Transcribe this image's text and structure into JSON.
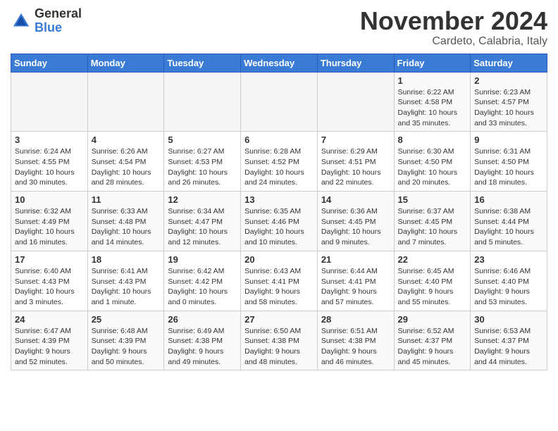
{
  "header": {
    "logo_general": "General",
    "logo_blue": "Blue",
    "month_title": "November 2024",
    "location": "Cardeto, Calabria, Italy"
  },
  "days_of_week": [
    "Sunday",
    "Monday",
    "Tuesday",
    "Wednesday",
    "Thursday",
    "Friday",
    "Saturday"
  ],
  "weeks": [
    [
      {
        "day": "",
        "info": ""
      },
      {
        "day": "",
        "info": ""
      },
      {
        "day": "",
        "info": ""
      },
      {
        "day": "",
        "info": ""
      },
      {
        "day": "",
        "info": ""
      },
      {
        "day": "1",
        "info": "Sunrise: 6:22 AM\nSunset: 4:58 PM\nDaylight: 10 hours and 35 minutes."
      },
      {
        "day": "2",
        "info": "Sunrise: 6:23 AM\nSunset: 4:57 PM\nDaylight: 10 hours and 33 minutes."
      }
    ],
    [
      {
        "day": "3",
        "info": "Sunrise: 6:24 AM\nSunset: 4:55 PM\nDaylight: 10 hours and 30 minutes."
      },
      {
        "day": "4",
        "info": "Sunrise: 6:26 AM\nSunset: 4:54 PM\nDaylight: 10 hours and 28 minutes."
      },
      {
        "day": "5",
        "info": "Sunrise: 6:27 AM\nSunset: 4:53 PM\nDaylight: 10 hours and 26 minutes."
      },
      {
        "day": "6",
        "info": "Sunrise: 6:28 AM\nSunset: 4:52 PM\nDaylight: 10 hours and 24 minutes."
      },
      {
        "day": "7",
        "info": "Sunrise: 6:29 AM\nSunset: 4:51 PM\nDaylight: 10 hours and 22 minutes."
      },
      {
        "day": "8",
        "info": "Sunrise: 6:30 AM\nSunset: 4:50 PM\nDaylight: 10 hours and 20 minutes."
      },
      {
        "day": "9",
        "info": "Sunrise: 6:31 AM\nSunset: 4:50 PM\nDaylight: 10 hours and 18 minutes."
      }
    ],
    [
      {
        "day": "10",
        "info": "Sunrise: 6:32 AM\nSunset: 4:49 PM\nDaylight: 10 hours and 16 minutes."
      },
      {
        "day": "11",
        "info": "Sunrise: 6:33 AM\nSunset: 4:48 PM\nDaylight: 10 hours and 14 minutes."
      },
      {
        "day": "12",
        "info": "Sunrise: 6:34 AM\nSunset: 4:47 PM\nDaylight: 10 hours and 12 minutes."
      },
      {
        "day": "13",
        "info": "Sunrise: 6:35 AM\nSunset: 4:46 PM\nDaylight: 10 hours and 10 minutes."
      },
      {
        "day": "14",
        "info": "Sunrise: 6:36 AM\nSunset: 4:45 PM\nDaylight: 10 hours and 9 minutes."
      },
      {
        "day": "15",
        "info": "Sunrise: 6:37 AM\nSunset: 4:45 PM\nDaylight: 10 hours and 7 minutes."
      },
      {
        "day": "16",
        "info": "Sunrise: 6:38 AM\nSunset: 4:44 PM\nDaylight: 10 hours and 5 minutes."
      }
    ],
    [
      {
        "day": "17",
        "info": "Sunrise: 6:40 AM\nSunset: 4:43 PM\nDaylight: 10 hours and 3 minutes."
      },
      {
        "day": "18",
        "info": "Sunrise: 6:41 AM\nSunset: 4:43 PM\nDaylight: 10 hours and 1 minute."
      },
      {
        "day": "19",
        "info": "Sunrise: 6:42 AM\nSunset: 4:42 PM\nDaylight: 10 hours and 0 minutes."
      },
      {
        "day": "20",
        "info": "Sunrise: 6:43 AM\nSunset: 4:41 PM\nDaylight: 9 hours and 58 minutes."
      },
      {
        "day": "21",
        "info": "Sunrise: 6:44 AM\nSunset: 4:41 PM\nDaylight: 9 hours and 57 minutes."
      },
      {
        "day": "22",
        "info": "Sunrise: 6:45 AM\nSunset: 4:40 PM\nDaylight: 9 hours and 55 minutes."
      },
      {
        "day": "23",
        "info": "Sunrise: 6:46 AM\nSunset: 4:40 PM\nDaylight: 9 hours and 53 minutes."
      }
    ],
    [
      {
        "day": "24",
        "info": "Sunrise: 6:47 AM\nSunset: 4:39 PM\nDaylight: 9 hours and 52 minutes."
      },
      {
        "day": "25",
        "info": "Sunrise: 6:48 AM\nSunset: 4:39 PM\nDaylight: 9 hours and 50 minutes."
      },
      {
        "day": "26",
        "info": "Sunrise: 6:49 AM\nSunset: 4:38 PM\nDaylight: 9 hours and 49 minutes."
      },
      {
        "day": "27",
        "info": "Sunrise: 6:50 AM\nSunset: 4:38 PM\nDaylight: 9 hours and 48 minutes."
      },
      {
        "day": "28",
        "info": "Sunrise: 6:51 AM\nSunset: 4:38 PM\nDaylight: 9 hours and 46 minutes."
      },
      {
        "day": "29",
        "info": "Sunrise: 6:52 AM\nSunset: 4:37 PM\nDaylight: 9 hours and 45 minutes."
      },
      {
        "day": "30",
        "info": "Sunrise: 6:53 AM\nSunset: 4:37 PM\nDaylight: 9 hours and 44 minutes."
      }
    ]
  ]
}
